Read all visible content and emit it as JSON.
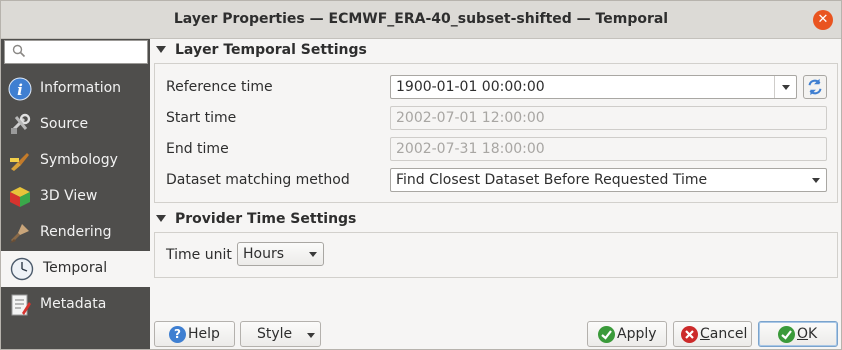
{
  "window": {
    "title": "Layer Properties — ECMWF_ERA-40_subset-shifted — Temporal",
    "close_glyph": "✕"
  },
  "sidebar": {
    "search_placeholder": "",
    "items": [
      {
        "label": "Information",
        "icon": "information-icon"
      },
      {
        "label": "Source",
        "icon": "source-icon"
      },
      {
        "label": "Symbology",
        "icon": "symbology-icon"
      },
      {
        "label": "3D View",
        "icon": "3d-view-icon"
      },
      {
        "label": "Rendering",
        "icon": "rendering-icon"
      },
      {
        "label": "Temporal",
        "icon": "clock-icon",
        "active": true
      },
      {
        "label": "Metadata",
        "icon": "metadata-icon"
      }
    ]
  },
  "layer_temporal": {
    "heading": "Layer Temporal Settings",
    "reference_time_label": "Reference time",
    "reference_time_value": "1900-01-01 00:00:00",
    "start_time_label": "Start time",
    "start_time_value": "2002-07-01 12:00:00",
    "end_time_label": "End time",
    "end_time_value": "2002-07-31 18:00:00",
    "matching_label": "Dataset matching method",
    "matching_value": "Find Closest Dataset Before Requested Time"
  },
  "provider_time": {
    "heading": "Provider Time Settings",
    "time_unit_label": "Time unit",
    "time_unit_value": "Hours"
  },
  "buttons": {
    "help": "Help",
    "style": "Style",
    "apply": "Apply",
    "cancel_prefix": "",
    "cancel_u": "C",
    "cancel_rest": "ancel",
    "ok_u": "O",
    "ok_rest": "K"
  },
  "colors": {
    "sidebar_bg": "#4f4e4c",
    "close_button": "#e95420",
    "help_icon": "#3f7fd1",
    "apply_icon": "#3a9a3a",
    "cancel_icon": "#cc2a2a"
  }
}
